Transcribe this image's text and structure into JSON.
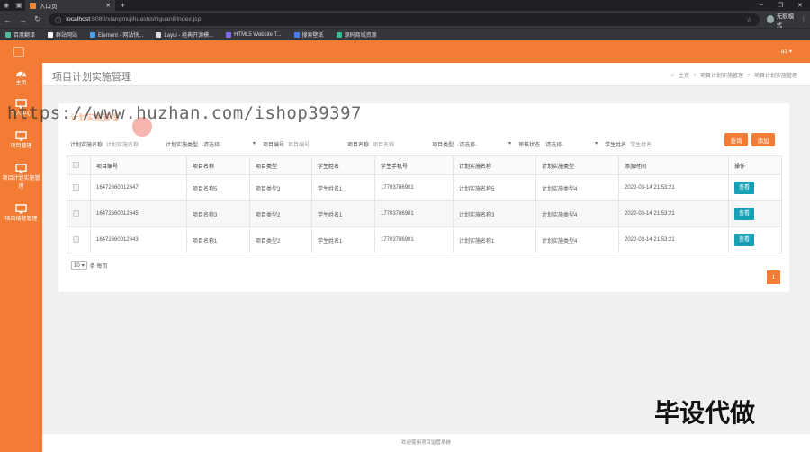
{
  "browser": {
    "tab_title": "入口页",
    "url_host": "localhost",
    "url_path": ":8080/xiangmujihuashishiguanli/index.jsp",
    "profile_label": "无痕模式",
    "bookmarks": [
      "百度翻译",
      "群站网站",
      "Element - 网站快...",
      "Layui - 经典开源模...",
      "HTML5 Website T...",
      "搜索壁纸",
      "源码商城资源"
    ]
  },
  "topbar": {
    "user_label": "a1"
  },
  "sidebar": {
    "items": [
      {
        "label": "主页",
        "icon": "dashboard-icon"
      },
      {
        "label": "个人中心",
        "icon": "monitor-icon"
      },
      {
        "label": "项目管理",
        "icon": "monitor-icon"
      },
      {
        "label": "项目计划实施管理",
        "icon": "monitor-icon"
      },
      {
        "label": "项目结题管理",
        "icon": "monitor-icon"
      }
    ]
  },
  "page": {
    "title": "项目计划实施管理",
    "breadcrumb": [
      "主页",
      "项目计划实施管理",
      "项目计划实施管理"
    ],
    "ghost_tab": "计划实施管理"
  },
  "filters": [
    {
      "label": "计划实施名称",
      "placeholder": "计划实施名称",
      "type": "input"
    },
    {
      "label": "计划实施类型",
      "value": "-请选择-",
      "type": "select"
    },
    {
      "label": "项目编号",
      "placeholder": "项目编号",
      "type": "input"
    },
    {
      "label": "项目名称",
      "placeholder": "项目名称",
      "type": "input"
    },
    {
      "label": "项目类型",
      "value": "-请选择-",
      "type": "select"
    },
    {
      "label": "审核状态",
      "value": "-请选择-",
      "type": "select"
    },
    {
      "label": "学生姓名",
      "placeholder": "学生姓名",
      "type": "input"
    }
  ],
  "buttons": {
    "search": "查询",
    "add": "添加",
    "view": "查看"
  },
  "table": {
    "headers": [
      "项目编号",
      "项目名称",
      "项目类型",
      "学生姓名",
      "学生手机号",
      "计划实施名称",
      "计划实施类型",
      "添加时间",
      "操作"
    ],
    "rows": [
      [
        "16472660012647",
        "项目名称5",
        "项目类型3",
        "学生姓名1",
        "17703786901",
        "计划实施名称5",
        "计划实施类型4",
        "2022-03-14 21:53:21"
      ],
      [
        "16472660012645",
        "项目名称3",
        "项目类型2",
        "学生姓名1",
        "17703786901",
        "计划实施名称3",
        "计划实施类型4",
        "2022-03-14 21:53:21"
      ],
      [
        "16472660012643",
        "项目名称1",
        "项目类型2",
        "学生姓名1",
        "17703786901",
        "计划实施名称1",
        "计划实施类型4",
        "2022-03-14 21:53:21"
      ]
    ]
  },
  "pager": {
    "page_size": "10",
    "page_size_suffix": "条 每页",
    "current_page": "1"
  },
  "footer": "欢迎使用项目监管系统",
  "watermarks": {
    "url": "https://www.huzhan.com/ishop39397",
    "cn": "毕设代做"
  },
  "colors": {
    "accent": "#f37c34",
    "teal": "#1aa0b4"
  }
}
